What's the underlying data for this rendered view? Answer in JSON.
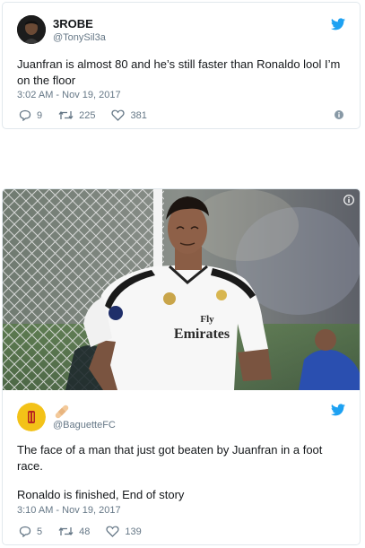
{
  "tweet1": {
    "author_name": "3ROBE",
    "author_handle": "@TonySil3a",
    "text_line1": "Juanfran is almost 80 and he’s still faster than Ronaldo lool I’m",
    "text_line2": "on the floor",
    "timestamp": "3:02 AM - Nov 19, 2017",
    "reply_count": "9",
    "retweet_count": "225",
    "like_count": "381"
  },
  "tweet2": {
    "jersey_text1": "Fly",
    "jersey_text2": "Emirates",
    "author_handle": "@BaguetteFC",
    "text_line1": "The face of a man that just got beaten by Juanfran in a foot",
    "text_line2": "race.",
    "text_line3": "Ronaldo is finished, End of story",
    "timestamp": "3:10 AM - Nov 19, 2017",
    "reply_count": "5",
    "retweet_count": "48",
    "like_count": "139"
  },
  "colors": {
    "twitter_blue": "#1da1f2",
    "meta_gray": "#657786",
    "border": "#e1e8ed"
  },
  "icons": [
    "twitter-bird-icon",
    "reply-icon",
    "retweet-icon",
    "heart-icon",
    "info-icon",
    "bandage-emoji-icon"
  ]
}
